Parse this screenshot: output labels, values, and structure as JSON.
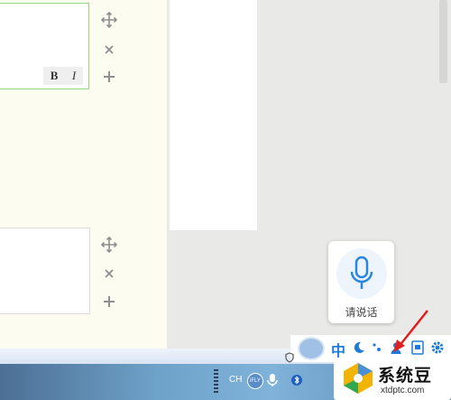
{
  "editor": {
    "format_bold": "B",
    "format_italic": "I"
  },
  "voice": {
    "label": "请说话"
  },
  "ime": {
    "lang": "中"
  },
  "taskbar": {
    "lang": "CH",
    "ifly_badge": "iFLY"
  },
  "watermark": {
    "text": "系统豆",
    "url": "xtdptc.com"
  },
  "colors": {
    "accent": "#1f7bd8",
    "arrow": "#e02020",
    "box_border": "#9cd67c"
  }
}
